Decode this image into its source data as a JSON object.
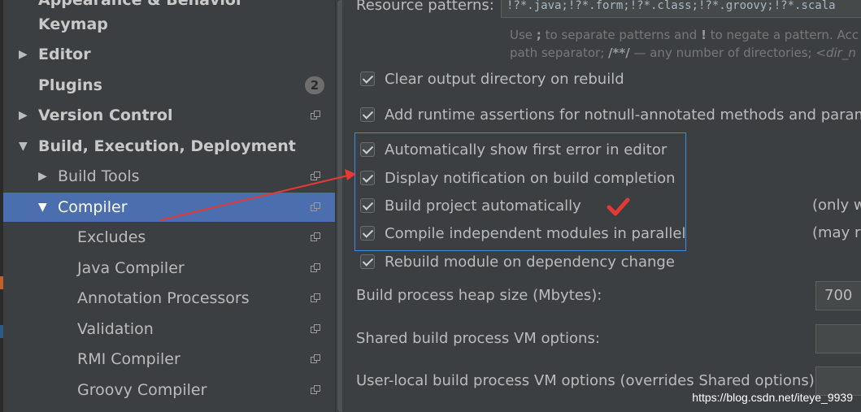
{
  "sidebar": {
    "items": [
      {
        "label": "Appearance & Behavior",
        "bold": true
      },
      {
        "label": "Keymap",
        "bold": true
      },
      {
        "label": "Editor",
        "bold": true
      },
      {
        "label": "Plugins",
        "bold": true,
        "badge": "2"
      },
      {
        "label": "Version Control",
        "bold": true
      },
      {
        "label": "Build, Execution, Deployment",
        "bold": true
      },
      {
        "label": "Build Tools"
      },
      {
        "label": "Compiler",
        "selected": true
      },
      {
        "label": "Excludes"
      },
      {
        "label": "Java Compiler"
      },
      {
        "label": "Annotation Processors"
      },
      {
        "label": "Validation"
      },
      {
        "label": "RMI Compiler"
      },
      {
        "label": "Groovy Compiler"
      }
    ]
  },
  "main": {
    "resource_patterns_label": "Resource patterns:",
    "resource_patterns_value": "!?*.java;!?*.form;!?*.class;!?*.groovy;!?*.scala",
    "hint_line1_a": "Use ",
    "hint_line1_b": ";",
    "hint_line1_c": " to separate patterns and ",
    "hint_line1_d": "!",
    "hint_line1_e": " to negate a pattern. Acc",
    "hint_line2_a": "path separator; ",
    "hint_line2_b": "/**/",
    "hint_line2_c": " — any number of directories; ",
    "hint_line2_d": "<dir_n",
    "checkboxes": [
      {
        "label": "Clear output directory on rebuild",
        "checked": true
      },
      {
        "label": "Add runtime assertions for notnull-annotated methods and paramet",
        "checked": true
      },
      {
        "label": "Automatically show first error in editor",
        "checked": true
      },
      {
        "label": "Display notification on build completion",
        "checked": true
      },
      {
        "label": "Build project automatically",
        "checked": true
      },
      {
        "label": "Compile independent modules in parallel",
        "checked": true
      },
      {
        "label": "Rebuild module on dependency change",
        "checked": true
      }
    ],
    "side_note_auto": "(only w",
    "side_note_parallel": "(may re",
    "heap_label": "Build process heap size (Mbytes):",
    "heap_value": "700",
    "shared_vm_label": "Shared build process VM options:",
    "shared_vm_value": "",
    "user_vm_label": "User-local build process VM options (overrides Shared options):",
    "user_vm_value": ""
  },
  "annotations": {
    "arrow_color": "#e53935",
    "checkmark_color": "#e53935",
    "box_color": "#3b8ede"
  },
  "watermark": "https://blog.csdn.net/iteye_9939"
}
